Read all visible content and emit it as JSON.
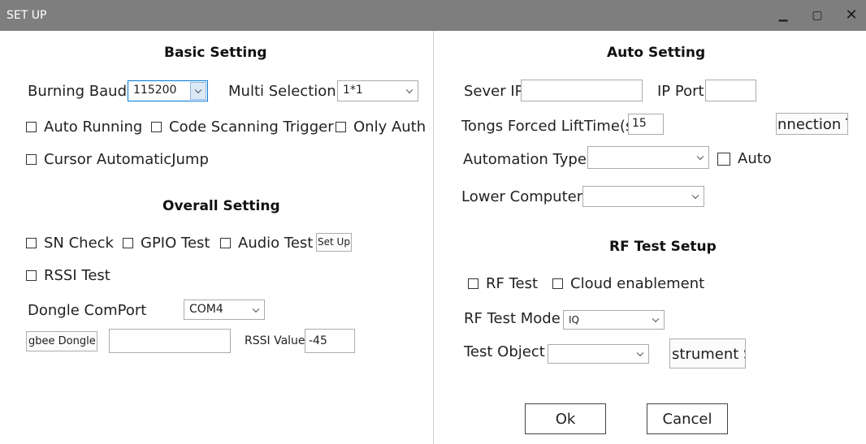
{
  "window": {
    "title": "SET UP",
    "minimize_glyph": "▁",
    "maximize_glyph": "▢",
    "close_glyph": "✕"
  },
  "basic": {
    "title": "Basic Setting",
    "burning_baud_label": "Burning Baud",
    "burning_baud_value": "115200",
    "multi_selection_label": "Multi Selection",
    "multi_selection_value": "1*1",
    "auto_running": "Auto Running",
    "code_scanning_trigger": "Code Scanning Trigger",
    "only_auth": "Only Auth",
    "cursor_jump": "Cursor AutomaticJump"
  },
  "overall": {
    "title": "Overall Setting",
    "sn_check": "SN Check",
    "gpio_test": "GPIO Test",
    "audio_test": "Audio Test",
    "setup_button": "Set Up",
    "rssi_test": "RSSI Test",
    "dongle_comport_label": "Dongle ComPort",
    "dongle_comport_value": "COM4",
    "zigbee_button": "gbee Dongle M",
    "zigbee_value": "",
    "rssi_value_label": "RSSI Value",
    "rssi_value": "-45"
  },
  "auto": {
    "title": "Auto Setting",
    "sever_ip_label": "Sever IP",
    "sever_ip_value": "",
    "ip_port_label": "IP Port",
    "ip_port_value": "",
    "tongs_label": "Tongs Forced LiftTime(s)",
    "tongs_value": "15",
    "connection_button": "nnection T",
    "automation_type_label": "Automation Type",
    "automation_type_value": "",
    "auto_check": "Auto",
    "lower_computer_label": "Lower Computer",
    "lower_computer_value": ""
  },
  "rf": {
    "title": "RF Test Setup",
    "rf_test": "RF Test",
    "cloud_enablement": "Cloud enablement",
    "mode_label": "RF Test Mode",
    "mode_value": "IQ",
    "object_label": "Test Object",
    "object_value": "",
    "instrument_button": "strument S"
  },
  "footer": {
    "ok": "Ok",
    "cancel": "Cancel"
  }
}
